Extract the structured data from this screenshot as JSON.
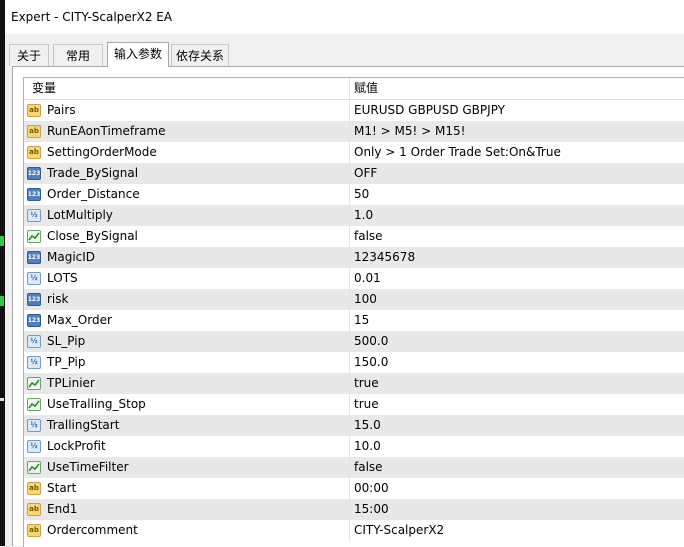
{
  "window": {
    "title": "Expert - CITY-ScalperX2 EA"
  },
  "tabs": [
    {
      "label": "关于",
      "active": false
    },
    {
      "label": "常用",
      "active": false
    },
    {
      "label": "输入参数",
      "active": true
    },
    {
      "label": "依存关系",
      "active": false
    }
  ],
  "table": {
    "headers": {
      "variable": "变量",
      "value": "赋值"
    },
    "rows": [
      {
        "name": "Pairs",
        "value": "EURUSD GBPUSD GBPJPY",
        "icon": "string-icon"
      },
      {
        "name": "RunEAonTimeframe",
        "value": "M1! > M5! > M15!",
        "icon": "string-icon"
      },
      {
        "name": "SettingOrderMode",
        "value": "Only > 1 Order Trade Set:On&True",
        "icon": "string-icon"
      },
      {
        "name": "Trade_BySignal",
        "value": "OFF",
        "icon": "integer-icon"
      },
      {
        "name": "Order_Distance",
        "value": "50",
        "icon": "integer-icon"
      },
      {
        "name": "LotMultiply",
        "value": "1.0",
        "icon": "double-icon"
      },
      {
        "name": "Close_BySignal",
        "value": "false",
        "icon": "boolean-icon"
      },
      {
        "name": "MagicID",
        "value": "12345678",
        "icon": "integer-icon"
      },
      {
        "name": "LOTS",
        "value": "0.01",
        "icon": "double-icon"
      },
      {
        "name": "risk",
        "value": "100",
        "icon": "integer-icon"
      },
      {
        "name": "Max_Order",
        "value": "15",
        "icon": "integer-icon"
      },
      {
        "name": "SL_Pip",
        "value": "500.0",
        "icon": "double-icon"
      },
      {
        "name": "TP_Pip",
        "value": "150.0",
        "icon": "double-icon"
      },
      {
        "name": "TPLinier",
        "value": "true",
        "icon": "boolean-icon"
      },
      {
        "name": "UseTralling_Stop",
        "value": "true",
        "icon": "boolean-icon"
      },
      {
        "name": "TrallingStart",
        "value": "15.0",
        "icon": "double-icon"
      },
      {
        "name": "LockProfit",
        "value": "10.0",
        "icon": "double-icon"
      },
      {
        "name": "UseTimeFilter",
        "value": "false",
        "icon": "boolean-icon"
      },
      {
        "name": "Start",
        "value": "00:00",
        "icon": "string-icon"
      },
      {
        "name": "End1",
        "value": "15:00",
        "icon": "string-icon"
      },
      {
        "name": "Ordercomment",
        "value": "CITY-ScalperX2",
        "icon": "string-icon"
      }
    ]
  },
  "icon_glyphs": {
    "string-icon": "ab",
    "integer-icon": "123",
    "double-icon": "½",
    "boolean-icon": ""
  },
  "colors": {
    "alt_row": "#e8e8e8",
    "window_bg": "#f0f0f0"
  }
}
